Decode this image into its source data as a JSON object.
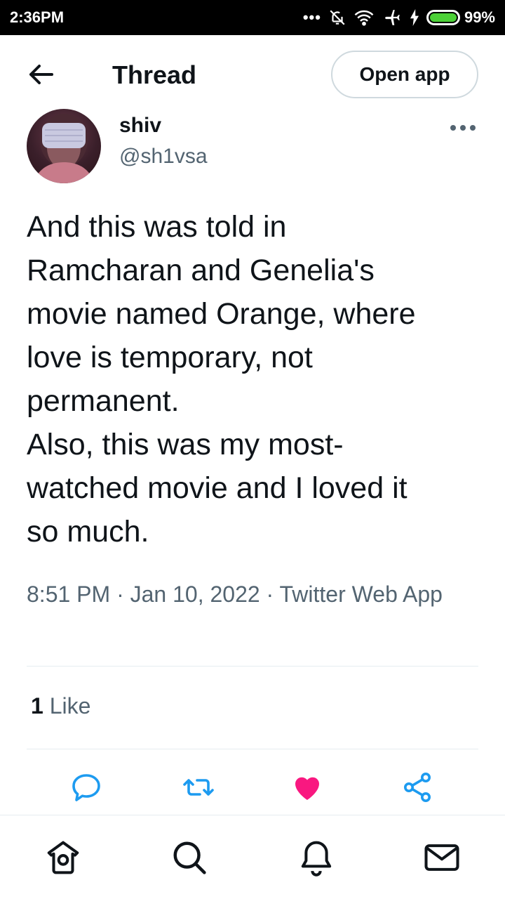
{
  "status_bar": {
    "time": "2:36PM",
    "battery": "99%",
    "battery_level": 0.99
  },
  "header": {
    "title": "Thread",
    "open_app_label": "Open app"
  },
  "tweet": {
    "author_name": "shiv",
    "author_handle": "@sh1vsa",
    "text": "And this was told in\nRamcharan and Genelia's\nmovie named Orange, where\nlove is temporary, not\npermanent.\nAlso, this was my most-\nwatched movie and I loved it\nso much.",
    "meta": "8:51 PM · Jan 10, 2022 · Twitter Web App",
    "like_count": "1",
    "like_label": "Like"
  },
  "colors": {
    "like": "#f91880",
    "muted": "#536471",
    "accent": "#1d9bf0",
    "text": "#0f1419"
  },
  "actions": [
    "reply-icon",
    "retweet-icon",
    "like-icon",
    "share-icon"
  ],
  "nav": [
    "home-icon",
    "search-icon",
    "notifications-icon",
    "messages-icon"
  ]
}
